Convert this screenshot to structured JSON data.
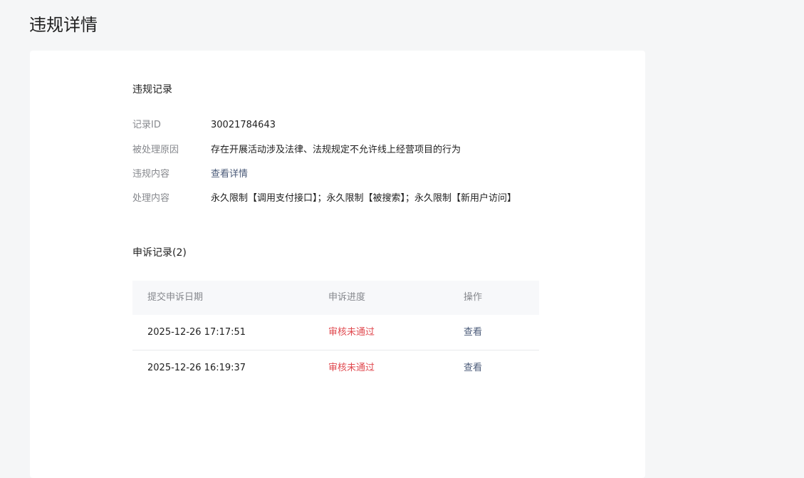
{
  "page": {
    "title": "违规详情"
  },
  "record": {
    "section_title": "违规记录",
    "fields": [
      {
        "label": "记录ID",
        "value": "30021784643"
      },
      {
        "label": "被处理原因",
        "value": "存在开展活动涉及法律、法规规定不允许线上经营项目的行为"
      },
      {
        "label": "违规内容",
        "value": "查看详情"
      },
      {
        "label": "处理内容",
        "value": "永久限制【调用支付接口】；永久限制【被搜索】；永久限制【新用户访问】"
      }
    ]
  },
  "appeals": {
    "section_title": "申诉记录(2)",
    "columns": {
      "date": "提交申诉日期",
      "status": "申诉进度",
      "action": "操作"
    },
    "rows": [
      {
        "date": "2025-12-26 17:17:51",
        "status": "审核未通过",
        "action": "查看"
      },
      {
        "date": "2025-12-26 16:19:37",
        "status": "审核未通过",
        "action": "查看"
      }
    ]
  },
  "colors": {
    "page_bg": "#f5f6f7",
    "card_bg": "#ffffff",
    "label": "#86888d",
    "link": "#4a5a78",
    "rejected": "#e0494f"
  }
}
